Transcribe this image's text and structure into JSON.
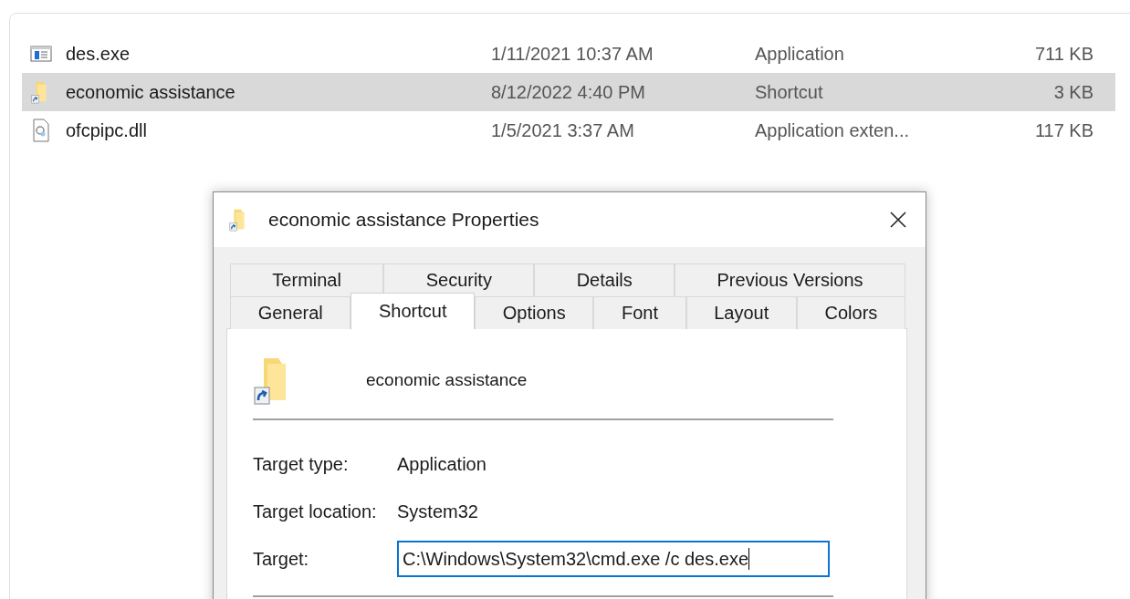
{
  "files": [
    {
      "name": "des.exe",
      "kind": "exe",
      "date": "1/11/2021 10:37 AM",
      "type": "Application",
      "size": "711 KB",
      "selected": false
    },
    {
      "name": "economic assistance",
      "kind": "shortcut",
      "date": "8/12/2022 4:40 PM",
      "type": "Shortcut",
      "size": "3 KB",
      "selected": true
    },
    {
      "name": "ofcpipc.dll",
      "kind": "dll",
      "date": "1/5/2021 3:37 AM",
      "type": "Application exten...",
      "size": "117 KB",
      "selected": false
    }
  ],
  "dialog": {
    "title": "economic assistance Properties",
    "tab_rows": [
      [
        {
          "label": "Terminal",
          "selected": false
        },
        {
          "label": "Security",
          "selected": false
        },
        {
          "label": "Details",
          "selected": false
        },
        {
          "label": "Previous Versions",
          "selected": false
        }
      ],
      [
        {
          "label": "General",
          "selected": false
        },
        {
          "label": "Shortcut",
          "selected": true
        },
        {
          "label": "Options",
          "selected": false
        },
        {
          "label": "Font",
          "selected": false
        },
        {
          "label": "Layout",
          "selected": false
        },
        {
          "label": "Colors",
          "selected": false
        }
      ]
    ],
    "name": "economic assistance",
    "fields": [
      {
        "label": "Target type:",
        "value": "Application",
        "kind": "text"
      },
      {
        "label": "Target location:",
        "value": "System32",
        "kind": "text"
      },
      {
        "label": "Target:",
        "value": "C:\\Windows\\System32\\cmd.exe /c des.exe",
        "kind": "input"
      }
    ]
  }
}
